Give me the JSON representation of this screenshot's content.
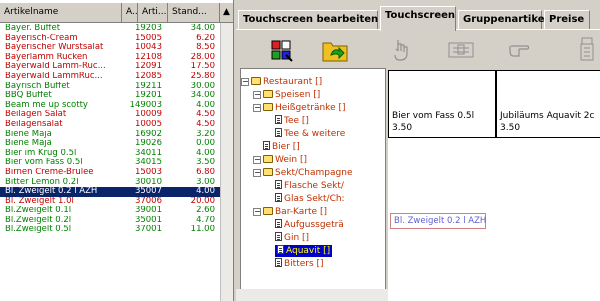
{
  "table": {
    "headers": [
      "Artikelname",
      "A...",
      "Arti...",
      "Stand..."
    ],
    "rows": [
      {
        "name": "Bayer. Buffet",
        "art": "19203",
        "price": "34.00",
        "color": "#008000"
      },
      {
        "name": "Bayerisch-Cream",
        "art": "15005",
        "price": "6.20",
        "color": "#c00000"
      },
      {
        "name": "Bayerischer Wurstsalat",
        "art": "10043",
        "price": "8.50",
        "color": "#c00000"
      },
      {
        "name": "Bayerlamm Rücken",
        "art": "12108",
        "price": "28.00",
        "color": "#c00000"
      },
      {
        "name": "Bayerwald Lamm-Rüc...",
        "art": "12091",
        "price": "17.50",
        "color": "#c00000"
      },
      {
        "name": "Bayerwald LammRüc...",
        "art": "12085",
        "price": "25.80",
        "color": "#c00000"
      },
      {
        "name": "Bayrisch Büffet",
        "art": "19211",
        "price": "30.00",
        "color": "#008000"
      },
      {
        "name": "BBQ Buffet",
        "art": "19201",
        "price": "34.00",
        "color": "#008000"
      },
      {
        "name": "Beam me up scotty",
        "art": "149003",
        "price": "4.00",
        "color": "#008000"
      },
      {
        "name": "Beilagen Salat",
        "art": "10009",
        "price": "4.50",
        "color": "#c00000"
      },
      {
        "name": "Beilagensalat",
        "art": "10005",
        "price": "4.50",
        "color": "#c00000"
      },
      {
        "name": "Biene Maja",
        "art": "16902",
        "price": "3.20",
        "color": "#008000"
      },
      {
        "name": "Biene Maja",
        "art": "19026",
        "price": "0.00",
        "color": "#008000"
      },
      {
        "name": "Bier im Krug 0.5l",
        "art": "34011",
        "price": "4.00",
        "color": "#008000"
      },
      {
        "name": "Bier vom Fass 0.5l",
        "art": "34015",
        "price": "3.50",
        "color": "#008000"
      },
      {
        "name": "Birnen Creme-Brulee",
        "art": "15003",
        "price": "6.80",
        "color": "#c00000"
      },
      {
        "name": "Bitter Lemon 0.2l",
        "art": "30010",
        "price": "3.00",
        "color": "#008000"
      },
      {
        "name": "Bl. Zweigelt 0.2 l AZH",
        "art": "35007",
        "price": "4.00",
        "color": "#ffffff",
        "selected": true
      },
      {
        "name": "Bl. Zweigelt 1.0l",
        "art": "37006",
        "price": "20.00",
        "color": "#c00000"
      },
      {
        "name": "Bl.Zweigelt 0.1l",
        "art": "39001",
        "price": "2.60",
        "color": "#008000"
      },
      {
        "name": "Bl.Zweigelt 0.2l",
        "art": "35001",
        "price": "4.70",
        "color": "#008000"
      },
      {
        "name": "Bl.Zweigelt 0.5l",
        "art": "37001",
        "price": "11.00",
        "color": "#008000"
      }
    ]
  },
  "tabs": [
    "Touchscreen bearbeiten",
    "Touchscreen",
    "Gruppenartikel",
    "Preise"
  ],
  "tree": [
    {
      "label": "Restaurant []",
      "level": 0,
      "type": "folder"
    },
    {
      "label": "Speisen []",
      "level": 1,
      "type": "folder"
    },
    {
      "label": "Heißgetränke []",
      "level": 1,
      "type": "folder"
    },
    {
      "label": "Tee []",
      "level": 2,
      "type": "doc"
    },
    {
      "label": "Tee & weitere",
      "level": 2,
      "type": "doc"
    },
    {
      "label": "Bier []",
      "level": 1,
      "type": "doc"
    },
    {
      "label": "Wein []",
      "level": 1,
      "type": "folder"
    },
    {
      "label": "Sekt/Champagne",
      "level": 1,
      "type": "folder"
    },
    {
      "label": "Flasche Sekt/",
      "level": 2,
      "type": "doc"
    },
    {
      "label": "Glas Sekt/Ch:",
      "level": 2,
      "type": "doc"
    },
    {
      "label": "Bar-Karte []",
      "level": 1,
      "type": "folder"
    },
    {
      "label": "Aufgussgeträ",
      "level": 2,
      "type": "doc"
    },
    {
      "label": "Gin []",
      "level": 2,
      "type": "doc"
    },
    {
      "label": "Aquavit []",
      "level": 2,
      "type": "doc",
      "selected": true
    },
    {
      "label": "Bitters []",
      "level": 2,
      "type": "doc"
    }
  ],
  "grid": {
    "cells": [
      {
        "name": "Bier vom Fass 0.5l",
        "price": "3.50"
      },
      {
        "name": "Jubiläums Aquavit 2c",
        "price": "3.50"
      }
    ],
    "selected_item": "Bl. Zweigelt 0.2 l AZH"
  },
  "icons": [
    "grid-edit-icon",
    "folder-arrow-icon",
    "hand-point-icon",
    "keyboard-icon",
    "hand-pointer-icon",
    "device-icon"
  ]
}
